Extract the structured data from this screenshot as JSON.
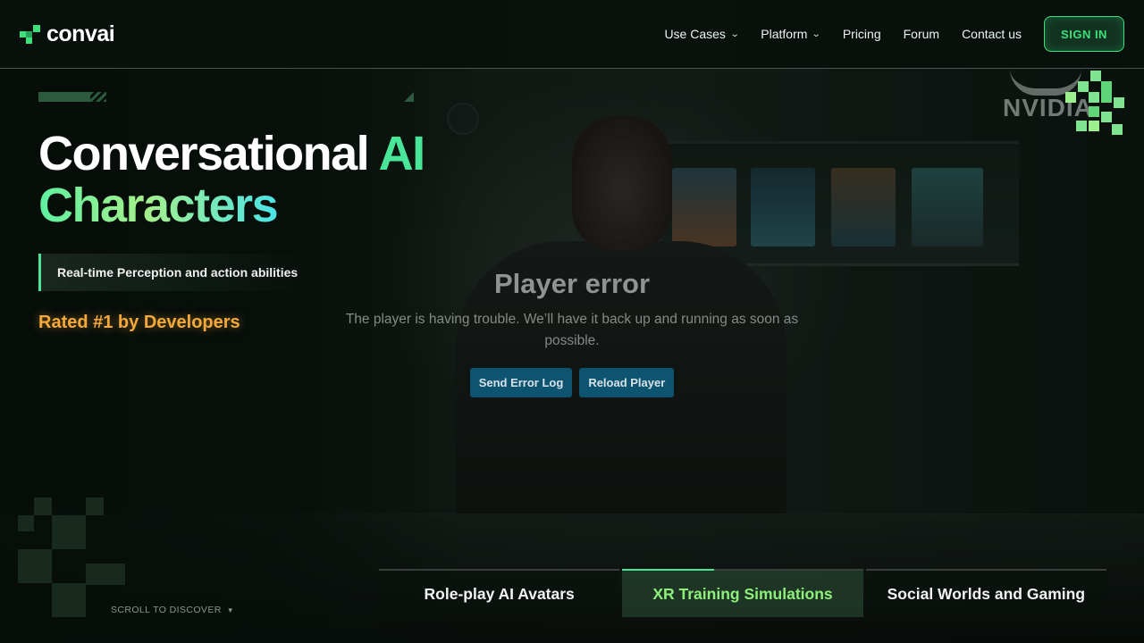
{
  "brand": {
    "name": "convai",
    "accent": "#3ee07a"
  },
  "nav": {
    "items": [
      {
        "label": "Use Cases",
        "has_dropdown": true
      },
      {
        "label": "Platform",
        "has_dropdown": true
      },
      {
        "label": "Pricing",
        "has_dropdown": false
      },
      {
        "label": "Forum",
        "has_dropdown": false
      },
      {
        "label": "Contact us",
        "has_dropdown": false
      }
    ],
    "signin_label": "SIGN IN"
  },
  "hero": {
    "title_line1_plain": "Conversational ",
    "title_line1_accent": "AI",
    "title_line2": "Characters",
    "feature": "Real-time Perception and action abilities",
    "rated": "Rated #1 by Developers"
  },
  "player_error": {
    "title": "Player error",
    "message": "The player is having trouble. We’ll have it back up and running as soon as possible.",
    "buttons": [
      "Send Error Log",
      "Reload Player"
    ]
  },
  "partner": {
    "name": "NVIDIA"
  },
  "scroll": {
    "label": "SCROLL TO DISCOVER"
  },
  "tabs": [
    {
      "label": "Role-play AI Avatars",
      "active": false
    },
    {
      "label": "XR Training Simulations",
      "active": true,
      "progress": 0.38
    },
    {
      "label": "Social Worlds and Gaming",
      "active": false
    }
  ],
  "colors": {
    "accent_green": "#49e69a",
    "rated_orange": "#f5a93a",
    "error_button": "#0c5470"
  }
}
